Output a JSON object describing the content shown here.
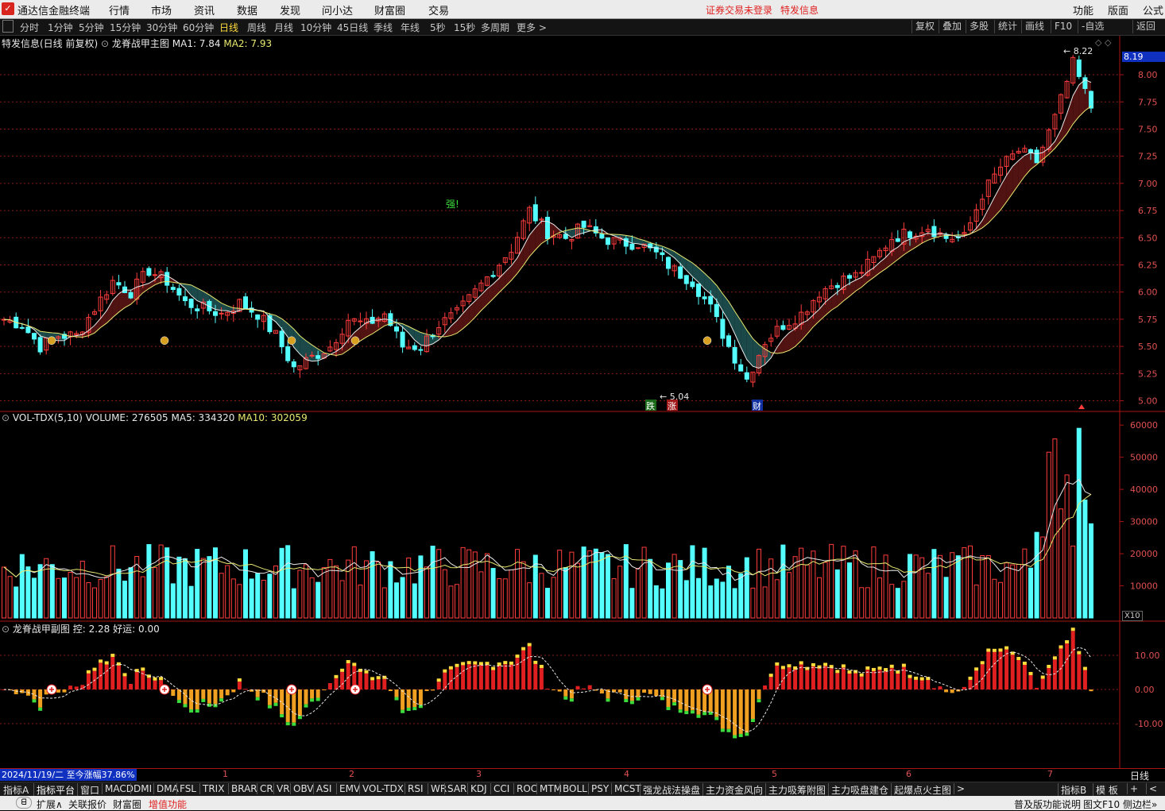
{
  "menubar": {
    "app_title": "通达信金融终端",
    "items": [
      "行情",
      "市场",
      "资讯",
      "数据",
      "发现",
      "问小达",
      "财富圈",
      "交易"
    ],
    "login_notice": "证券交易未登录",
    "stock_name": "特发信息",
    "right_items": [
      "功能",
      "版面",
      "公式"
    ]
  },
  "toolbar": {
    "periods": [
      "分时",
      "1分钟",
      "5分钟",
      "15分钟",
      "30分钟",
      "60分钟",
      "日线",
      "周线",
      "月线",
      "10分钟",
      "45日线",
      "季线",
      "年线",
      "5秒",
      "15秒",
      "多周期",
      "更多 >"
    ],
    "active_period": "日线",
    "right_buttons": [
      "复权",
      "叠加",
      "多股",
      "统计",
      "画线",
      "F10",
      "-自选",
      "返回"
    ]
  },
  "main_panel": {
    "title": "特发信息(日线 前复权)",
    "indicator_name": "龙脊战甲主图",
    "ma1": "MA1: 7.84",
    "ma2": "MA2: 7.93",
    "current_price_tag": "8.19",
    "high_marker": "8.22",
    "low_marker": "5.04",
    "strong_marker": "强!",
    "event_tags": [
      "跌",
      "涨",
      "财"
    ],
    "y_ticks": [
      "8.00",
      "7.75",
      "7.50",
      "7.25",
      "7.00",
      "6.75",
      "6.50",
      "6.25",
      "6.00",
      "5.75",
      "5.50",
      "5.25",
      "5.00"
    ]
  },
  "volume_panel": {
    "title": "VOL-TDX(5,10)",
    "volume": "VOLUME: 276505",
    "ma5": "MA5: 334320",
    "ma10": "MA10: 302059",
    "y_ticks": [
      "60000",
      "50000",
      "40000",
      "30000",
      "20000",
      "10000"
    ],
    "unit": "X10"
  },
  "sub_panel": {
    "title": "龙脊战甲副图",
    "kong": "控: 2.28",
    "haoyun": "好运: 0.00",
    "y_ticks": [
      "10.00",
      "0.00",
      "-10.00"
    ]
  },
  "date_bar": {
    "cursor_date": "2024/11/19/二",
    "gain_since": "至今涨幅37.86%",
    "month_labels": [
      "1",
      "2",
      "3",
      "4",
      "5",
      "6",
      "7"
    ],
    "period_label": "日线"
  },
  "indicator_tabs": [
    "指标A",
    "指标平台",
    "窗口",
    "MACD",
    "DMI",
    "DMA",
    "FSL",
    "TRIX",
    "BRAR",
    "CR",
    "VR",
    "OBV",
    "ASI",
    "EMV",
    "VOL-TDX",
    "RSI",
    "WR",
    "SAR",
    "KDJ",
    "CCI",
    "ROC",
    "MTM",
    "BOLL",
    "PSY",
    "MCST",
    "强龙战法操盘",
    "主力资金风向",
    "主力吸筹附图",
    "主力吸盘建仓",
    "起爆点火主图",
    ">"
  ],
  "indicator_tabs_right": [
    "指标B",
    "模 板",
    "+",
    "<"
  ],
  "statusbar": {
    "toggle": "ᗺ",
    "items": [
      "扩展∧",
      "关联报价",
      "财富圈",
      "增值功能"
    ],
    "right_items": [
      "普及版功能说明",
      "图文F10",
      "侧边栏»"
    ]
  },
  "colors": {
    "up": "#ff3c3c",
    "down": "#54ffff",
    "accent": "#ffdc3c",
    "grid": "#8a1a1a",
    "ribbon_up": "#5a1414",
    "ribbon_down": "#1e5050"
  },
  "chart_data": {
    "type": "candlestick",
    "price_axis_range": [
      5.0,
      8.22
    ],
    "close_path": [
      5.75,
      5.7,
      5.5,
      5.6,
      5.6,
      5.85,
      6.1,
      6.0,
      6.2,
      6.1,
      5.9,
      5.85,
      5.8,
      5.9,
      5.8,
      5.6,
      5.3,
      5.4,
      5.5,
      5.75,
      5.7,
      5.8,
      5.5,
      5.5,
      5.7,
      5.8,
      6.0,
      6.2,
      6.4,
      6.75,
      6.55,
      6.5,
      6.6,
      6.5,
      6.45,
      6.45,
      6.35,
      6.2,
      6.1,
      5.85,
      5.5,
      5.2,
      5.55,
      5.7,
      5.8,
      6.0,
      6.1,
      6.15,
      6.3,
      6.5,
      6.55,
      6.6,
      6.5,
      6.5,
      6.9,
      7.15,
      7.3,
      7.2,
      7.6,
      8.1,
      7.7
    ],
    "volume_axis_range": [
      0,
      60000
    ],
    "sub_axis_range": [
      -10,
      10
    ]
  }
}
